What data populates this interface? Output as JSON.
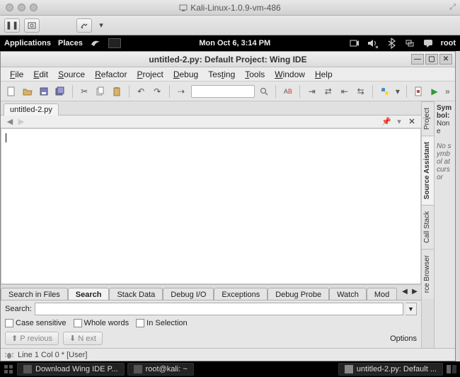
{
  "mac_title": "Kali-Linux-1.0.9-vm-486",
  "gnome": {
    "menu_applications": "Applications",
    "menu_places": "Places",
    "clock": "Mon Oct  6,  3:14 PM",
    "user": "root"
  },
  "wing": {
    "title": "untitled-2.py: Default Project: Wing IDE",
    "menus": {
      "file": "File",
      "edit": "Edit",
      "source": "Source",
      "refactor": "Refactor",
      "project": "Project",
      "debug": "Debug",
      "testing": "Testing",
      "tools": "Tools",
      "window": "Window",
      "help": "Help"
    },
    "toolbar_search": "",
    "file_tab": "untitled-2.py",
    "editor_content": "",
    "bottom_tabs": {
      "search_in_files": "Search in Files",
      "search": "Search",
      "stack_data": "Stack Data",
      "debug_io": "Debug I/O",
      "exceptions": "Exceptions",
      "debug_probe": "Debug Probe",
      "watch": "Watch",
      "modules": "Mod"
    },
    "search_panel": {
      "label": "Search:",
      "value": "",
      "case_sensitive": "Case sensitive",
      "whole_words": "Whole words",
      "in_selection": "In Selection",
      "previous": "Previous",
      "next": "Next",
      "options": "Options"
    },
    "side_tabs": {
      "project": "Project",
      "source_assistant": "Source Assistant",
      "call_stack": "Call Stack",
      "browser": "rce Browser"
    },
    "symbol": {
      "hdr": "Symbol:",
      "val": "None",
      "msg": "No symbol at cursor"
    },
    "status": "Line 1 Col 0 * [User]"
  },
  "taskbar": {
    "t1": "Download Wing IDE P...",
    "t2": "root@kali: ~",
    "t3": "untitled-2.py: Default ..."
  }
}
